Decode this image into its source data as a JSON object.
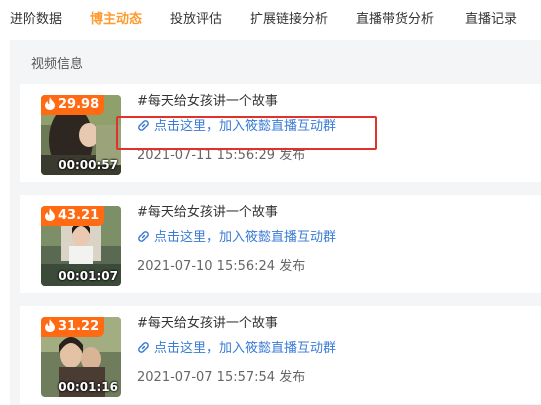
{
  "tabs": [
    {
      "label": "进阶数据",
      "active": false
    },
    {
      "label": "博主动态",
      "active": true
    },
    {
      "label": "投放评估",
      "active": false
    },
    {
      "label": "扩展链接分析",
      "active": false
    },
    {
      "label": "直播带货分析",
      "active": false
    },
    {
      "label": "直播记录",
      "active": false
    }
  ],
  "section": {
    "title": "视频信息"
  },
  "colors": {
    "accent": "#ff9a2e",
    "badge": "#ff6a13",
    "link": "#3a7bd5",
    "highlight": "#e0322a"
  },
  "videos": [
    {
      "heat": "29.98",
      "duration": "00:00:57",
      "title": "#每天给女孩讲一个故事",
      "link": "点击这里，加入筱懿直播互动群",
      "date": "2021-07-11 15:56:29 发布",
      "link_icon": "link-icon",
      "badge_icon": "flame-icon"
    },
    {
      "heat": "43.21",
      "duration": "00:01:07",
      "title": "#每天给女孩讲一个故事",
      "link": "点击这里，加入筱懿直播互动群",
      "date": "2021-07-10 15:56:24 发布",
      "link_icon": "link-icon",
      "badge_icon": "flame-icon"
    },
    {
      "heat": "31.22",
      "duration": "00:01:16",
      "title": "#每天给女孩讲一个故事",
      "link": "点击这里，加入筱懿直播互动群",
      "date": "2021-07-07 15:57:54 发布",
      "link_icon": "link-icon",
      "badge_icon": "flame-icon"
    }
  ]
}
